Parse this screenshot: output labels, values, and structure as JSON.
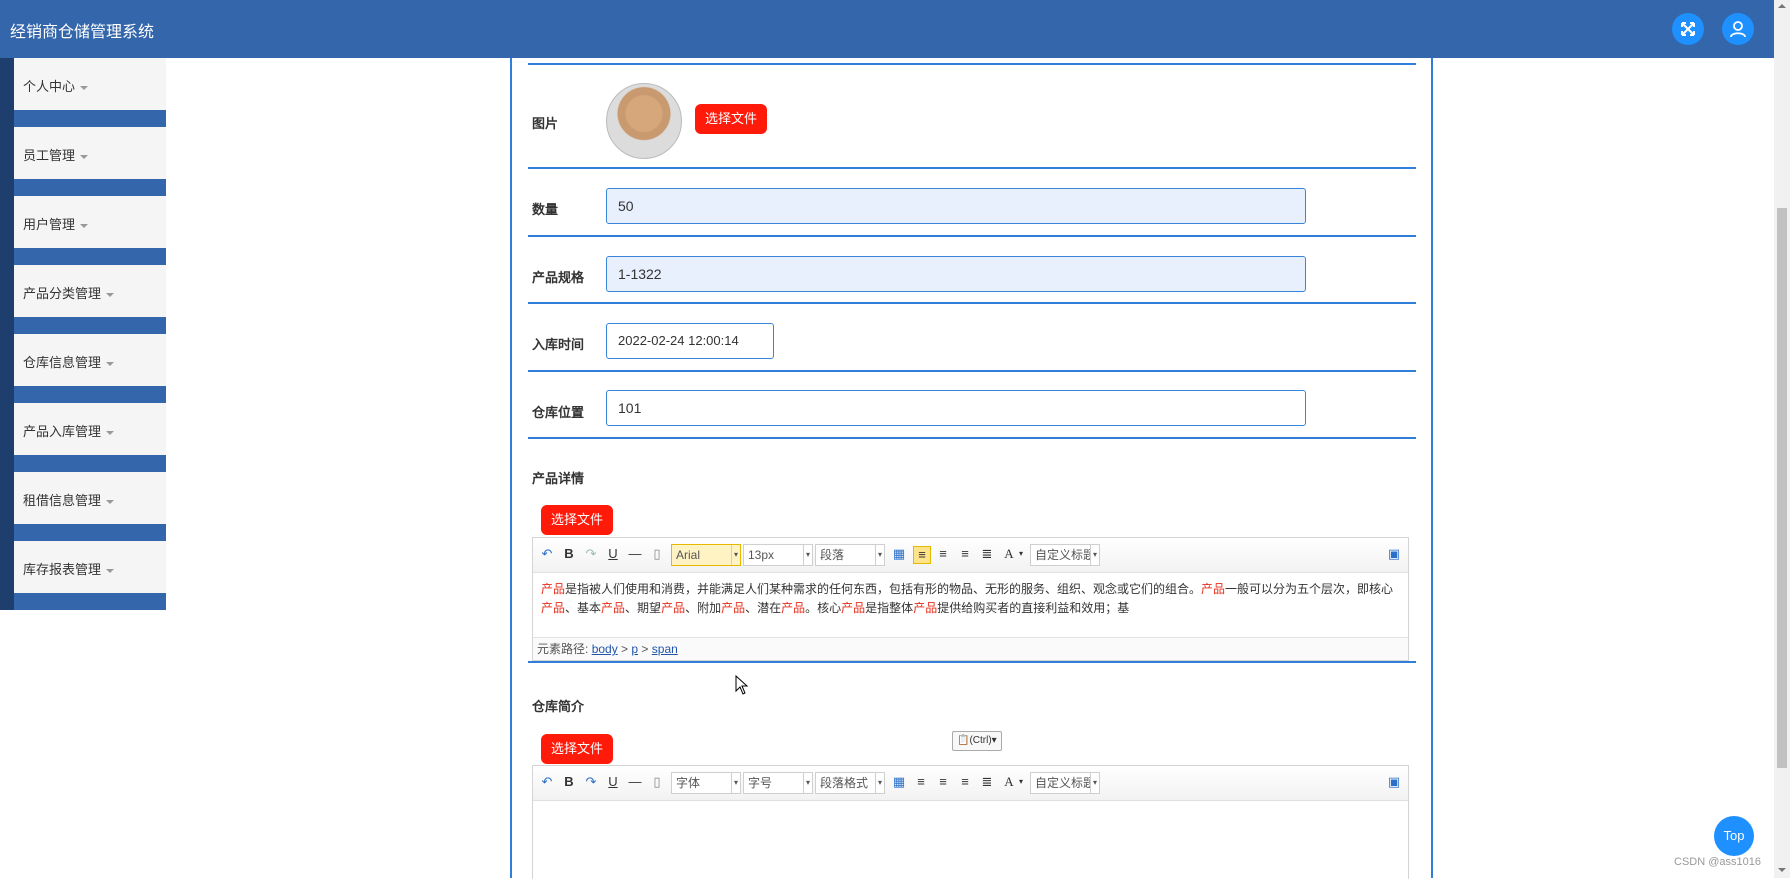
{
  "header": {
    "title": "经销商仓储管理系统"
  },
  "sidebar": {
    "items": [
      {
        "label": "个人中心"
      },
      {
        "label": "员工管理"
      },
      {
        "label": "用户管理"
      },
      {
        "label": "产品分类管理"
      },
      {
        "label": "仓库信息管理"
      },
      {
        "label": "产品入库管理"
      },
      {
        "label": "租借信息管理"
      },
      {
        "label": "库存报表管理"
      }
    ]
  },
  "form": {
    "picture": {
      "label": "图片",
      "button": "选择文件"
    },
    "quantity": {
      "label": "数量",
      "value": "50"
    },
    "spec": {
      "label": "产品规格",
      "value": "1-1322"
    },
    "intime": {
      "label": "入库时间",
      "value": "2022-02-24 12:00:14"
    },
    "location": {
      "label": "仓库位置",
      "value": "101"
    },
    "details": {
      "label": "产品详情",
      "button": "选择文件",
      "font": "Arial",
      "size": "13px",
      "para": "段落",
      "heading": "自定义标题",
      "content_segments": [
        {
          "t": "产品",
          "red": true
        },
        {
          "t": "是指被人们使用和消费，并能满足人们某种需求的任何东西，包括有形的物品、无形的服务、组织、观念或它们的组合。",
          "red": false
        },
        {
          "t": "产品",
          "red": true
        },
        {
          "t": "一般可以分为五个层次，即核心",
          "red": false
        },
        {
          "t": "产品",
          "red": true
        },
        {
          "t": "、基本",
          "red": false
        },
        {
          "t": "产品",
          "red": true
        },
        {
          "t": "、期望",
          "red": false
        },
        {
          "t": "产品",
          "red": true
        },
        {
          "t": "、附加",
          "red": false
        },
        {
          "t": "产品",
          "red": true
        },
        {
          "t": "、潜在",
          "red": false
        },
        {
          "t": "产品",
          "red": true
        },
        {
          "t": "。核心",
          "red": false
        },
        {
          "t": "产品",
          "red": true
        },
        {
          "t": "是指整体",
          "red": false
        },
        {
          "t": "产品",
          "red": true
        },
        {
          "t": "提供给购买者的直接利益和效用；基",
          "red": false
        }
      ],
      "path_label": "元素路径:",
      "path": [
        "body",
        "p",
        "span"
      ]
    },
    "intro": {
      "label": "仓库简介",
      "button": "选择文件",
      "font": "字体",
      "size": "字号",
      "para": "段落格式",
      "heading": "自定义标题"
    }
  },
  "paste_hint": "(Ctrl)",
  "top_button": "Top",
  "watermark": "CSDN @ass1016"
}
